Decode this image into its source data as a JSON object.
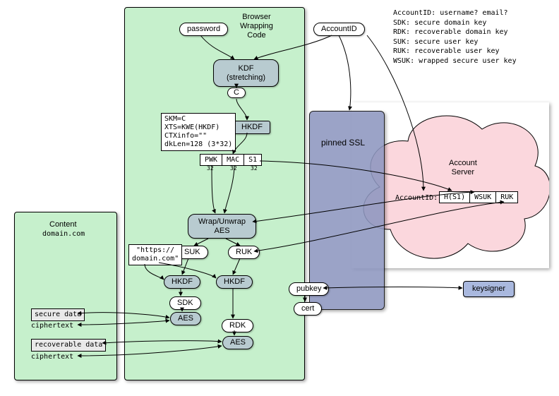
{
  "titles": {
    "browser": "Browser\nWrapping\nCode",
    "content": "Content",
    "content_sub": "domain.com",
    "cloud": "Account\nServer",
    "ssl": "pinned SSL"
  },
  "nodes": {
    "password": "password",
    "accountid": "AccountID",
    "kdf": "KDF\n(stretching)",
    "c": "C",
    "hkdf1": "HKDF",
    "wrap": "Wrap/Unwrap\nAES",
    "suk": "SUK",
    "ruk": "RUK",
    "hkdf2": "HKDF",
    "hkdf3": "HKDF",
    "sdk": "SDK",
    "rdk": "RDK",
    "aes1": "AES",
    "aes2": "AES",
    "pubkey": "pubkey",
    "cert": "cert",
    "keysigner": "keysigner"
  },
  "boxes": {
    "hkdf_params": "SKM=C\nXTS=KWE(HKDF)\nCTXinfo=\"\"\ndkLen=128 (3*32)",
    "url": "\"https://\ndomain.com\"",
    "secure_data": "secure data",
    "recoverable_data": "recoverable data",
    "ciphertext1": "ciphertext",
    "ciphertext2": "ciphertext"
  },
  "cells": {
    "pwk": [
      "PWK",
      "MAC",
      "S1"
    ],
    "pwk_sub": [
      "32",
      "32",
      "32"
    ],
    "account_row_label": "AccountID:",
    "account_row": [
      "H(S1)",
      "WSUK",
      "RUK"
    ]
  },
  "legend": "AccountID: username? email?\nSDK: secure domain key\nRDK: recoverable domain key\nSUK: secure user key\nRUK: recoverable user key\nWSUK: wrapped secure user key"
}
